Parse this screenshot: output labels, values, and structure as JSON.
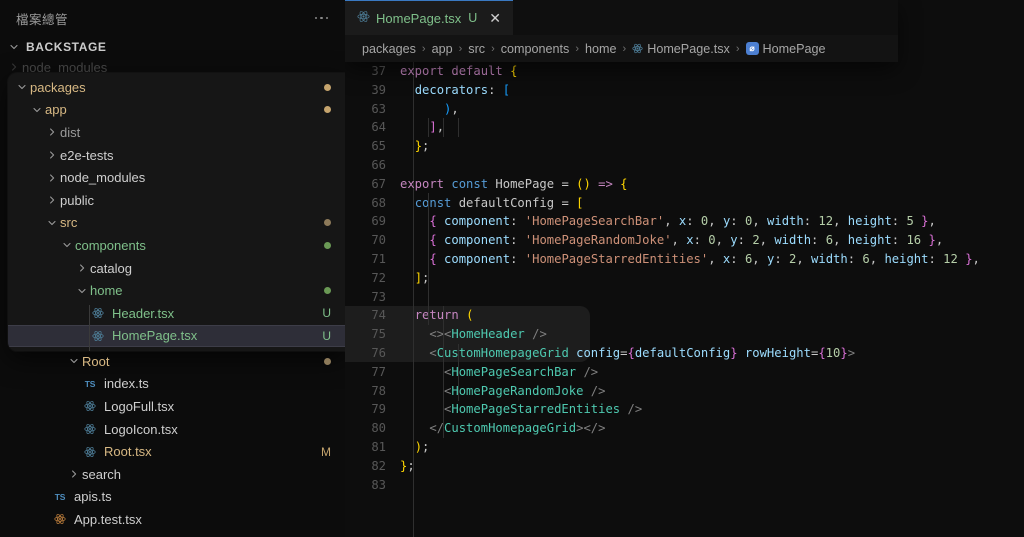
{
  "sidebar": {
    "title": "檔案總管",
    "more_icon": "ellipsis-icon",
    "root_folder": "BACKSTAGE",
    "rows_above": [
      {
        "label": "node_modules",
        "kind": "folder",
        "expanded": false,
        "indent": 1,
        "badge": "",
        "color": "#cfcfcf"
      }
    ],
    "rows_overlay": [
      {
        "label": "packages",
        "kind": "folder",
        "expanded": true,
        "indent": 1,
        "badge": "dot",
        "dot_color": "#c5a46d",
        "color": "#d8b984"
      },
      {
        "label": "app",
        "kind": "folder",
        "expanded": true,
        "indent": 2,
        "badge": "dot",
        "dot_color": "#c5a46d",
        "color": "#d8b984"
      },
      {
        "label": "dist",
        "kind": "folder",
        "expanded": false,
        "indent": 3,
        "badge": "",
        "color": "#9b9b9b"
      },
      {
        "label": "e2e-tests",
        "kind": "folder",
        "expanded": false,
        "indent": 3,
        "badge": "",
        "color": "#cfcfcf"
      },
      {
        "label": "node_modules",
        "kind": "folder",
        "expanded": false,
        "indent": 3,
        "badge": "",
        "color": "#cfcfcf"
      },
      {
        "label": "public",
        "kind": "folder",
        "expanded": false,
        "indent": 3,
        "badge": "",
        "color": "#cfcfcf"
      },
      {
        "label": "src",
        "kind": "folder",
        "expanded": true,
        "indent": 3,
        "badge": "dot",
        "dot_color": "#8d7a5a",
        "color": "#d8b984"
      },
      {
        "label": "components",
        "kind": "folder",
        "expanded": true,
        "indent": 4,
        "badge": "dot",
        "dot_color": "#6a9955",
        "color": "#7fc08a"
      },
      {
        "label": "catalog",
        "kind": "folder",
        "expanded": false,
        "indent": 5,
        "badge": "",
        "color": "#cfcfcf"
      },
      {
        "label": "home",
        "kind": "folder",
        "expanded": true,
        "indent": 5,
        "badge": "dot",
        "dot_color": "#6a9955",
        "color": "#7fc08a"
      },
      {
        "label": "Header.tsx",
        "kind": "react",
        "indent": 6,
        "badge": "U",
        "badge_color": "#7fc08a",
        "color": "#7fc08a",
        "icon_color": "#4d7c96",
        "selected": false
      },
      {
        "label": "HomePage.tsx",
        "kind": "react",
        "indent": 6,
        "badge": "U",
        "badge_color": "#7fc08a",
        "color": "#7fc08a",
        "icon_color": "#4d7c96",
        "selected": true
      }
    ],
    "rows_below": [
      {
        "label": "Root",
        "kind": "folder",
        "expanded": true,
        "indent": 5,
        "badge": "dot",
        "dot_color": "#8d7a5a",
        "color": "#d8b984"
      },
      {
        "label": "index.ts",
        "kind": "ts",
        "indent": 6,
        "badge": "",
        "color": "#cfcfcf",
        "icon_color": "#4f8fc0"
      },
      {
        "label": "LogoFull.tsx",
        "kind": "react",
        "indent": 6,
        "badge": "",
        "color": "#cfcfcf",
        "icon_color": "#4d7c96"
      },
      {
        "label": "LogoIcon.tsx",
        "kind": "react",
        "indent": 6,
        "badge": "",
        "color": "#cfcfcf",
        "icon_color": "#4d7c96"
      },
      {
        "label": "Root.tsx",
        "kind": "react",
        "indent": 6,
        "badge": "M",
        "badge_color": "#c5a46d",
        "color": "#d8b984",
        "icon_color": "#4d7c96"
      },
      {
        "label": "search",
        "kind": "folder",
        "expanded": false,
        "indent": 5,
        "badge": "",
        "color": "#cfcfcf"
      },
      {
        "label": "apis.ts",
        "kind": "ts",
        "indent": 4,
        "badge": "",
        "color": "#cfcfcf",
        "icon_color": "#4f8fc0"
      },
      {
        "label": "App.test.tsx",
        "kind": "react",
        "indent": 4,
        "badge": "",
        "color": "#cfcfcf",
        "icon_color": "#b5793a"
      }
    ]
  },
  "editor": {
    "tab": {
      "icon": "react-icon",
      "filename": "HomePage.tsx",
      "git_status": "U",
      "close_icon": "close-icon"
    },
    "breadcrumb": [
      {
        "label": "packages",
        "icon": ""
      },
      {
        "label": "app",
        "icon": ""
      },
      {
        "label": "src",
        "icon": ""
      },
      {
        "label": "components",
        "icon": ""
      },
      {
        "label": "home",
        "icon": ""
      },
      {
        "label": "HomePage.tsx",
        "icon": "react-icon"
      },
      {
        "label": "HomePage",
        "icon": "symbol-variable-icon"
      }
    ],
    "breadcrumb_separator": "›",
    "lines": [
      {
        "n": "37",
        "tokens": [
          {
            "t": "export ",
            "c": "t-kw"
          },
          {
            "t": "default ",
            "c": "t-kw"
          },
          {
            "t": "{",
            "c": "t-brk1"
          }
        ]
      },
      {
        "n": "39",
        "tokens": [
          {
            "t": "  ",
            "c": "t-pl"
          },
          {
            "t": "decorators",
            "c": "t-prop"
          },
          {
            "t": ": ",
            "c": "t-pl"
          },
          {
            "t": "[",
            "c": "t-brk3"
          }
        ]
      },
      {
        "n": "63",
        "tokens": [
          {
            "t": "      ",
            "c": "t-pl"
          },
          {
            "t": ")",
            "c": "t-brk3"
          },
          {
            "t": ",",
            "c": "t-pl"
          }
        ]
      },
      {
        "n": "64",
        "tokens": [
          {
            "t": "    ",
            "c": "t-pl"
          },
          {
            "t": "]",
            "c": "t-brk2"
          },
          {
            "t": ",",
            "c": "t-pl"
          }
        ]
      },
      {
        "n": "65",
        "tokens": [
          {
            "t": "  ",
            "c": "t-pl"
          },
          {
            "t": "}",
            "c": "t-brk1"
          },
          {
            "t": ";",
            "c": "t-pl"
          }
        ]
      },
      {
        "n": "66",
        "tokens": []
      },
      {
        "n": "67",
        "tokens": [
          {
            "t": "export ",
            "c": "t-kw"
          },
          {
            "t": "const ",
            "c": "t-kw2"
          },
          {
            "t": "HomePage",
            "c": "t-pl"
          },
          {
            "t": " = ",
            "c": "t-pl"
          },
          {
            "t": "()",
            "c": "t-brk1"
          },
          {
            "t": " => ",
            "c": "t-kw"
          },
          {
            "t": "{",
            "c": "t-brk1"
          }
        ]
      },
      {
        "n": "68",
        "tokens": [
          {
            "t": "  ",
            "c": "t-pl"
          },
          {
            "t": "const ",
            "c": "t-kw2"
          },
          {
            "t": "defaultConfig",
            "c": "t-pl"
          },
          {
            "t": " = ",
            "c": "t-pl"
          },
          {
            "t": "[",
            "c": "t-brk1"
          }
        ]
      },
      {
        "n": "69",
        "tokens": [
          {
            "t": "    ",
            "c": "t-pl"
          },
          {
            "t": "{",
            "c": "t-brk2"
          },
          {
            "t": " ",
            "c": "t-pl"
          },
          {
            "t": "component",
            "c": "t-prop"
          },
          {
            "t": ": ",
            "c": "t-pl"
          },
          {
            "t": "'HomePageSearchBar'",
            "c": "t-str"
          },
          {
            "t": ", ",
            "c": "t-pl"
          },
          {
            "t": "x",
            "c": "t-prop"
          },
          {
            "t": ": ",
            "c": "t-pl"
          },
          {
            "t": "0",
            "c": "t-num"
          },
          {
            "t": ", ",
            "c": "t-pl"
          },
          {
            "t": "y",
            "c": "t-prop"
          },
          {
            "t": ": ",
            "c": "t-pl"
          },
          {
            "t": "0",
            "c": "t-num"
          },
          {
            "t": ", ",
            "c": "t-pl"
          },
          {
            "t": "width",
            "c": "t-prop"
          },
          {
            "t": ": ",
            "c": "t-pl"
          },
          {
            "t": "12",
            "c": "t-num"
          },
          {
            "t": ", ",
            "c": "t-pl"
          },
          {
            "t": "height",
            "c": "t-prop"
          },
          {
            "t": ": ",
            "c": "t-pl"
          },
          {
            "t": "5",
            "c": "t-num"
          },
          {
            "t": " ",
            "c": "t-pl"
          },
          {
            "t": "}",
            "c": "t-brk2"
          },
          {
            "t": ",",
            "c": "t-pl"
          }
        ]
      },
      {
        "n": "70",
        "tokens": [
          {
            "t": "    ",
            "c": "t-pl"
          },
          {
            "t": "{",
            "c": "t-brk2"
          },
          {
            "t": " ",
            "c": "t-pl"
          },
          {
            "t": "component",
            "c": "t-prop"
          },
          {
            "t": ": ",
            "c": "t-pl"
          },
          {
            "t": "'HomePageRandomJoke'",
            "c": "t-str"
          },
          {
            "t": ", ",
            "c": "t-pl"
          },
          {
            "t": "x",
            "c": "t-prop"
          },
          {
            "t": ": ",
            "c": "t-pl"
          },
          {
            "t": "0",
            "c": "t-num"
          },
          {
            "t": ", ",
            "c": "t-pl"
          },
          {
            "t": "y",
            "c": "t-prop"
          },
          {
            "t": ": ",
            "c": "t-pl"
          },
          {
            "t": "2",
            "c": "t-num"
          },
          {
            "t": ", ",
            "c": "t-pl"
          },
          {
            "t": "width",
            "c": "t-prop"
          },
          {
            "t": ": ",
            "c": "t-pl"
          },
          {
            "t": "6",
            "c": "t-num"
          },
          {
            "t": ", ",
            "c": "t-pl"
          },
          {
            "t": "height",
            "c": "t-prop"
          },
          {
            "t": ": ",
            "c": "t-pl"
          },
          {
            "t": "16",
            "c": "t-num"
          },
          {
            "t": " ",
            "c": "t-pl"
          },
          {
            "t": "}",
            "c": "t-brk2"
          },
          {
            "t": ",",
            "c": "t-pl"
          }
        ]
      },
      {
        "n": "71",
        "tokens": [
          {
            "t": "    ",
            "c": "t-pl"
          },
          {
            "t": "{",
            "c": "t-brk2"
          },
          {
            "t": " ",
            "c": "t-pl"
          },
          {
            "t": "component",
            "c": "t-prop"
          },
          {
            "t": ": ",
            "c": "t-pl"
          },
          {
            "t": "'HomePageStarredEntities'",
            "c": "t-str"
          },
          {
            "t": ", ",
            "c": "t-pl"
          },
          {
            "t": "x",
            "c": "t-prop"
          },
          {
            "t": ": ",
            "c": "t-pl"
          },
          {
            "t": "6",
            "c": "t-num"
          },
          {
            "t": ", ",
            "c": "t-pl"
          },
          {
            "t": "y",
            "c": "t-prop"
          },
          {
            "t": ": ",
            "c": "t-pl"
          },
          {
            "t": "2",
            "c": "t-num"
          },
          {
            "t": ", ",
            "c": "t-pl"
          },
          {
            "t": "width",
            "c": "t-prop"
          },
          {
            "t": ": ",
            "c": "t-pl"
          },
          {
            "t": "6",
            "c": "t-num"
          },
          {
            "t": ", ",
            "c": "t-pl"
          },
          {
            "t": "height",
            "c": "t-prop"
          },
          {
            "t": ": ",
            "c": "t-pl"
          },
          {
            "t": "12",
            "c": "t-num"
          },
          {
            "t": " ",
            "c": "t-pl"
          },
          {
            "t": "}",
            "c": "t-brk2"
          },
          {
            "t": ",",
            "c": "t-pl"
          }
        ]
      },
      {
        "n": "72",
        "tokens": [
          {
            "t": "  ",
            "c": "t-pl"
          },
          {
            "t": "]",
            "c": "t-brk1"
          },
          {
            "t": ";",
            "c": "t-pl"
          }
        ]
      },
      {
        "n": "73",
        "tokens": []
      },
      {
        "n": "74",
        "tokens": [
          {
            "t": "  ",
            "c": "t-pl"
          },
          {
            "t": "return ",
            "c": "t-kw"
          },
          {
            "t": "(",
            "c": "t-brk1"
          }
        ]
      },
      {
        "n": "75",
        "tokens": [
          {
            "t": "    ",
            "c": "t-pl"
          },
          {
            "t": "<>",
            "c": "t-punc"
          },
          {
            "t": "<",
            "c": "t-punc"
          },
          {
            "t": "HomeHeader",
            "c": "t-cmp"
          },
          {
            "t": " />",
            "c": "t-punc"
          }
        ]
      },
      {
        "n": "76",
        "tokens": [
          {
            "t": "    ",
            "c": "t-pl"
          },
          {
            "t": "<",
            "c": "t-punc"
          },
          {
            "t": "CustomHomepageGrid",
            "c": "t-cmp"
          },
          {
            "t": " ",
            "c": "t-pl"
          },
          {
            "t": "config",
            "c": "t-attr"
          },
          {
            "t": "=",
            "c": "t-pl"
          },
          {
            "t": "{",
            "c": "t-brk2"
          },
          {
            "t": "defaultConfig",
            "c": "t-var"
          },
          {
            "t": "}",
            "c": "t-brk2"
          },
          {
            "t": " ",
            "c": "t-pl"
          },
          {
            "t": "rowHeight",
            "c": "t-attr"
          },
          {
            "t": "=",
            "c": "t-pl"
          },
          {
            "t": "{",
            "c": "t-brk2"
          },
          {
            "t": "10",
            "c": "t-num"
          },
          {
            "t": "}",
            "c": "t-brk2"
          },
          {
            "t": ">",
            "c": "t-punc"
          }
        ]
      },
      {
        "n": "77",
        "tokens": [
          {
            "t": "      ",
            "c": "t-pl"
          },
          {
            "t": "<",
            "c": "t-punc"
          },
          {
            "t": "HomePageSearchBar",
            "c": "t-cmp"
          },
          {
            "t": " />",
            "c": "t-punc"
          }
        ]
      },
      {
        "n": "78",
        "tokens": [
          {
            "t": "      ",
            "c": "t-pl"
          },
          {
            "t": "<",
            "c": "t-punc"
          },
          {
            "t": "HomePageRandomJoke",
            "c": "t-cmp"
          },
          {
            "t": " />",
            "c": "t-punc"
          }
        ]
      },
      {
        "n": "79",
        "tokens": [
          {
            "t": "      ",
            "c": "t-pl"
          },
          {
            "t": "<",
            "c": "t-punc"
          },
          {
            "t": "HomePageStarredEntities",
            "c": "t-cmp"
          },
          {
            "t": " />",
            "c": "t-punc"
          }
        ]
      },
      {
        "n": "80",
        "tokens": [
          {
            "t": "    ",
            "c": "t-pl"
          },
          {
            "t": "</",
            "c": "t-punc"
          },
          {
            "t": "CustomHomepageGrid",
            "c": "t-cmp"
          },
          {
            "t": ">",
            "c": "t-punc"
          },
          {
            "t": "</>",
            "c": "t-punc"
          }
        ]
      },
      {
        "n": "81",
        "tokens": [
          {
            "t": "  ",
            "c": "t-pl"
          },
          {
            "t": ")",
            "c": "t-brk1"
          },
          {
            "t": ";",
            "c": "t-pl"
          }
        ]
      },
      {
        "n": "82",
        "tokens": [
          {
            "t": "",
            "c": "t-pl"
          },
          {
            "t": "}",
            "c": "t-brk1"
          },
          {
            "t": ";",
            "c": "t-pl"
          }
        ]
      },
      {
        "n": "83",
        "tokens": []
      }
    ]
  },
  "colors": {
    "accent_tab_border": "#3a79c2",
    "editor_bg": "#0d0d0d",
    "sidebar_bg": "#0c0c0c",
    "overlay_bg": "#161616",
    "selection_bg": "#2e2e38",
    "untracked": "#7fc08a",
    "modified": "#c5a46d"
  }
}
